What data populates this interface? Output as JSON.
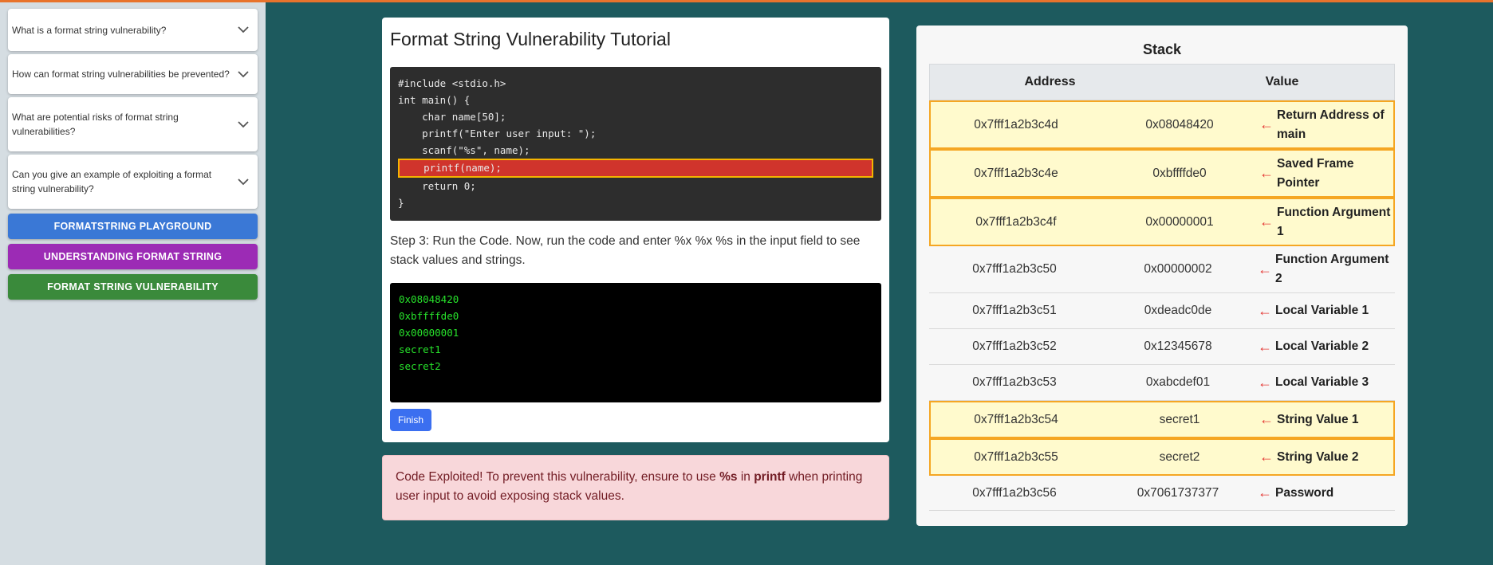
{
  "faq": [
    {
      "question": "What is a format string vulnerability?"
    },
    {
      "question": "How can format string vulnerabilities be prevented?"
    },
    {
      "question": "What are potential risks of format string vulnerabilities?"
    },
    {
      "question": "Can you give an example of exploiting a format string vulnerability?"
    }
  ],
  "nav": [
    {
      "label": "FORMATSTRING PLAYGROUND",
      "color": "#3a78d6"
    },
    {
      "label": "UNDERSTANDING FORMAT STRING",
      "color": "#9c2bb5"
    },
    {
      "label": "FORMAT STRING VULNERABILITY",
      "color": "#3a8a3b"
    }
  ],
  "tutorial": {
    "title": "Format String Vulnerability Tutorial",
    "code": [
      "#include <stdio.h>",
      "int main() {",
      "    char name[50];",
      "    printf(\"Enter user input: \");",
      "    scanf(\"%s\", name);",
      "    printf(name);",
      "    return 0;",
      "}"
    ],
    "step_text": "Step 3: Run the Code. Now, run the code and enter %x %x %s in the input field to see stack values and strings.",
    "output": [
      "0x08048420",
      "0xbffffde0",
      "0x00000001",
      "secret1",
      "secret2"
    ],
    "finish_label": "Finish"
  },
  "alert": {
    "prefix": "Code Exploited! To prevent this vulnerability, ensure to use ",
    "fmt": "%s",
    "mid": " in ",
    "fn": "printf",
    "suffix": " when printing user input to avoid exposing stack values."
  },
  "stack": {
    "title": "Stack",
    "headers": {
      "address": "Address",
      "value": "Value"
    },
    "rows": [
      {
        "address": "0x7fff1a2b3c4d",
        "value": "0x08048420",
        "arrow": "←",
        "label": "Return Address of main"
      },
      {
        "address": "0x7fff1a2b3c4e",
        "value": "0xbffffde0",
        "arrow": "←",
        "label": "Saved Frame Pointer"
      },
      {
        "address": "0x7fff1a2b3c4f",
        "value": "0x00000001",
        "arrow": "←",
        "label": "Function Argument 1"
      },
      {
        "address": "0x7fff1a2b3c50",
        "value": "0x00000002",
        "arrow": "←",
        "label": "Function Argument 2"
      },
      {
        "address": "0x7fff1a2b3c51",
        "value": "0xdeadc0de",
        "arrow": "←",
        "label": "Local Variable 1"
      },
      {
        "address": "0x7fff1a2b3c52",
        "value": "0x12345678",
        "arrow": "←",
        "label": "Local Variable 2"
      },
      {
        "address": "0x7fff1a2b3c53",
        "value": "0xabcdef01",
        "arrow": "←",
        "label": "Local Variable 3"
      },
      {
        "address": "0x7fff1a2b3c54",
        "value": "secret1",
        "arrow": "←",
        "label": "String Value 1"
      },
      {
        "address": "0x7fff1a2b3c55",
        "value": "secret2",
        "arrow": "←",
        "label": "String Value 2"
      },
      {
        "address": "0x7fff1a2b3c56",
        "value": "0x7061737377",
        "arrow": "←",
        "label": "Password"
      }
    ]
  }
}
